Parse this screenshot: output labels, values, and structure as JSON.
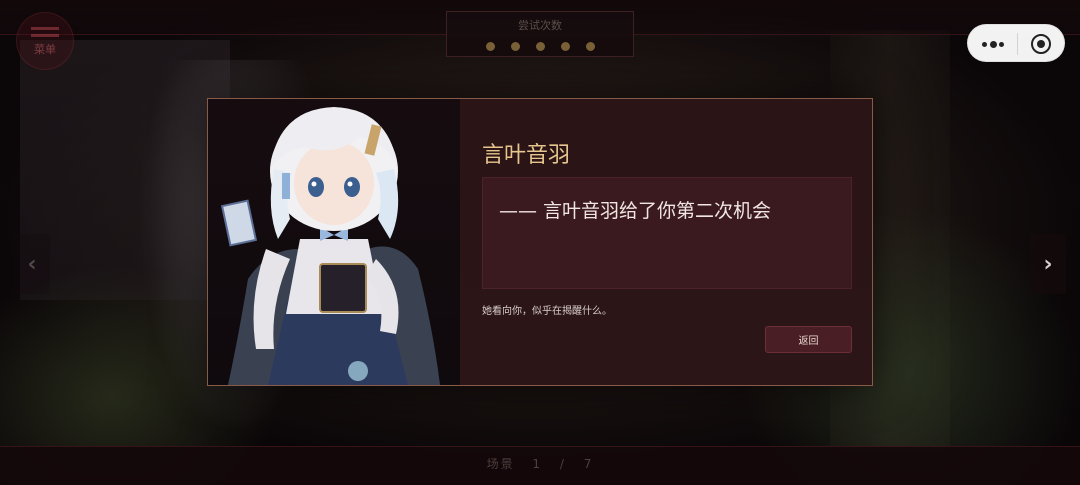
{
  "hud": {
    "menu_label": "菜单",
    "attempts_title": "尝试次数",
    "attempts_remaining": 5,
    "attempts_color": "#7a6138"
  },
  "scene": {
    "label": "场景",
    "current": "1",
    "separator": "/",
    "total": "7"
  },
  "dialog": {
    "character_name": "言叶音羽",
    "speech": "—— 言叶音羽给了你第二次机会",
    "narration": "她看向你，似乎在揭醒什么。",
    "return_label": "返回",
    "portrait_icon": "anime-girl-portrait"
  },
  "nav": {
    "prev_icon": "chevron-left-icon",
    "next_icon": "chevron-right-icon"
  },
  "colors": {
    "name_gold": "#e6c68e",
    "dialog_border": "#8a5a48",
    "button_bg": "#4a1e25"
  }
}
